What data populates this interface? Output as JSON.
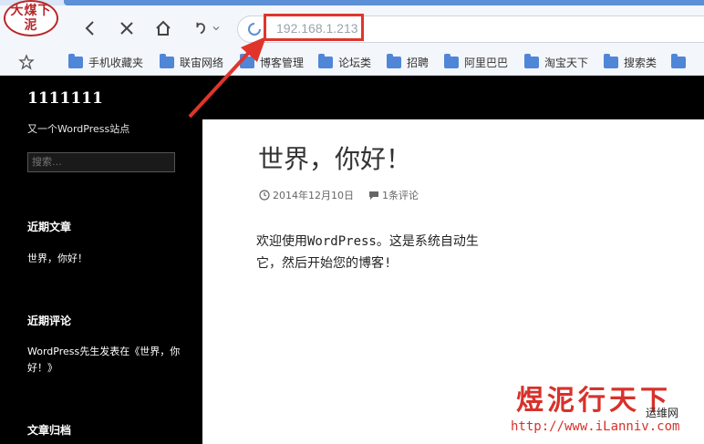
{
  "browser": {
    "logo_text": "大煤下泥",
    "url": "192.168.1.213",
    "bookmarks": [
      "手机收藏夹",
      "联宙网络",
      "博客管理",
      "论坛类",
      "招聘",
      "阿里巴巴",
      "淘宝天下",
      "搜索类"
    ]
  },
  "sidebar": {
    "site_title": "1111111",
    "site_desc": "又一个WordPress站点",
    "search_placeholder": "搜索…",
    "recent_posts_title": "近期文章",
    "recent_post": "世界，你好！",
    "recent_comments_title": "近期评论",
    "recent_comment": "WordPress先生发表在《世界，你好！》",
    "archives_title": "文章归档"
  },
  "post": {
    "title": "世界，你好！",
    "date": "2014年12月10日",
    "comments": "1条评论",
    "body_line1": "欢迎使用WordPress。这是系统自动生",
    "body_line2": "它，然后开始您的博客!"
  },
  "watermark": {
    "text": "煜泥行天下",
    "url": "http://www.iLanniv.com",
    "side": "运维网"
  },
  "colors": {
    "accent": "#5b8fd6",
    "highlight": "#e0342b",
    "sidebar_bg": "#000000"
  }
}
